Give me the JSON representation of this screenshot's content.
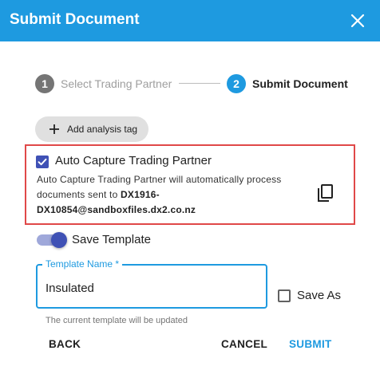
{
  "dialog": {
    "title": "Submit Document",
    "close_icon": "close-icon"
  },
  "stepper": {
    "steps": [
      {
        "number": "1",
        "label": "Select Trading Partner",
        "state": "inactive"
      },
      {
        "number": "2",
        "label": "Submit Document",
        "state": "active"
      }
    ]
  },
  "tag_button": {
    "icon": "plus-icon",
    "label": "Add analysis tag"
  },
  "auto_capture": {
    "checked": true,
    "title": "Auto Capture Trading Partner",
    "description": "Auto Capture Trading Partner will automatically process documents sent to ",
    "email_line1": "DX1916-",
    "email_line2": "DX10854@sandboxfiles.dx2.co.nz",
    "copy_icon": "copy-icon"
  },
  "save_template": {
    "on": true,
    "label": "Save Template"
  },
  "template_name": {
    "label": "Template Name *",
    "value": "Insulated",
    "helper": "The current template will be updated"
  },
  "save_as": {
    "checked": false,
    "label": "Save As"
  },
  "actions": {
    "back": "BACK",
    "cancel": "CANCEL",
    "submit": "SUBMIT"
  },
  "colors": {
    "header": "#1e9ae0",
    "primary": "#1e9ae0",
    "highlight_border": "#e04848",
    "checkbox": "#3f51b5"
  }
}
